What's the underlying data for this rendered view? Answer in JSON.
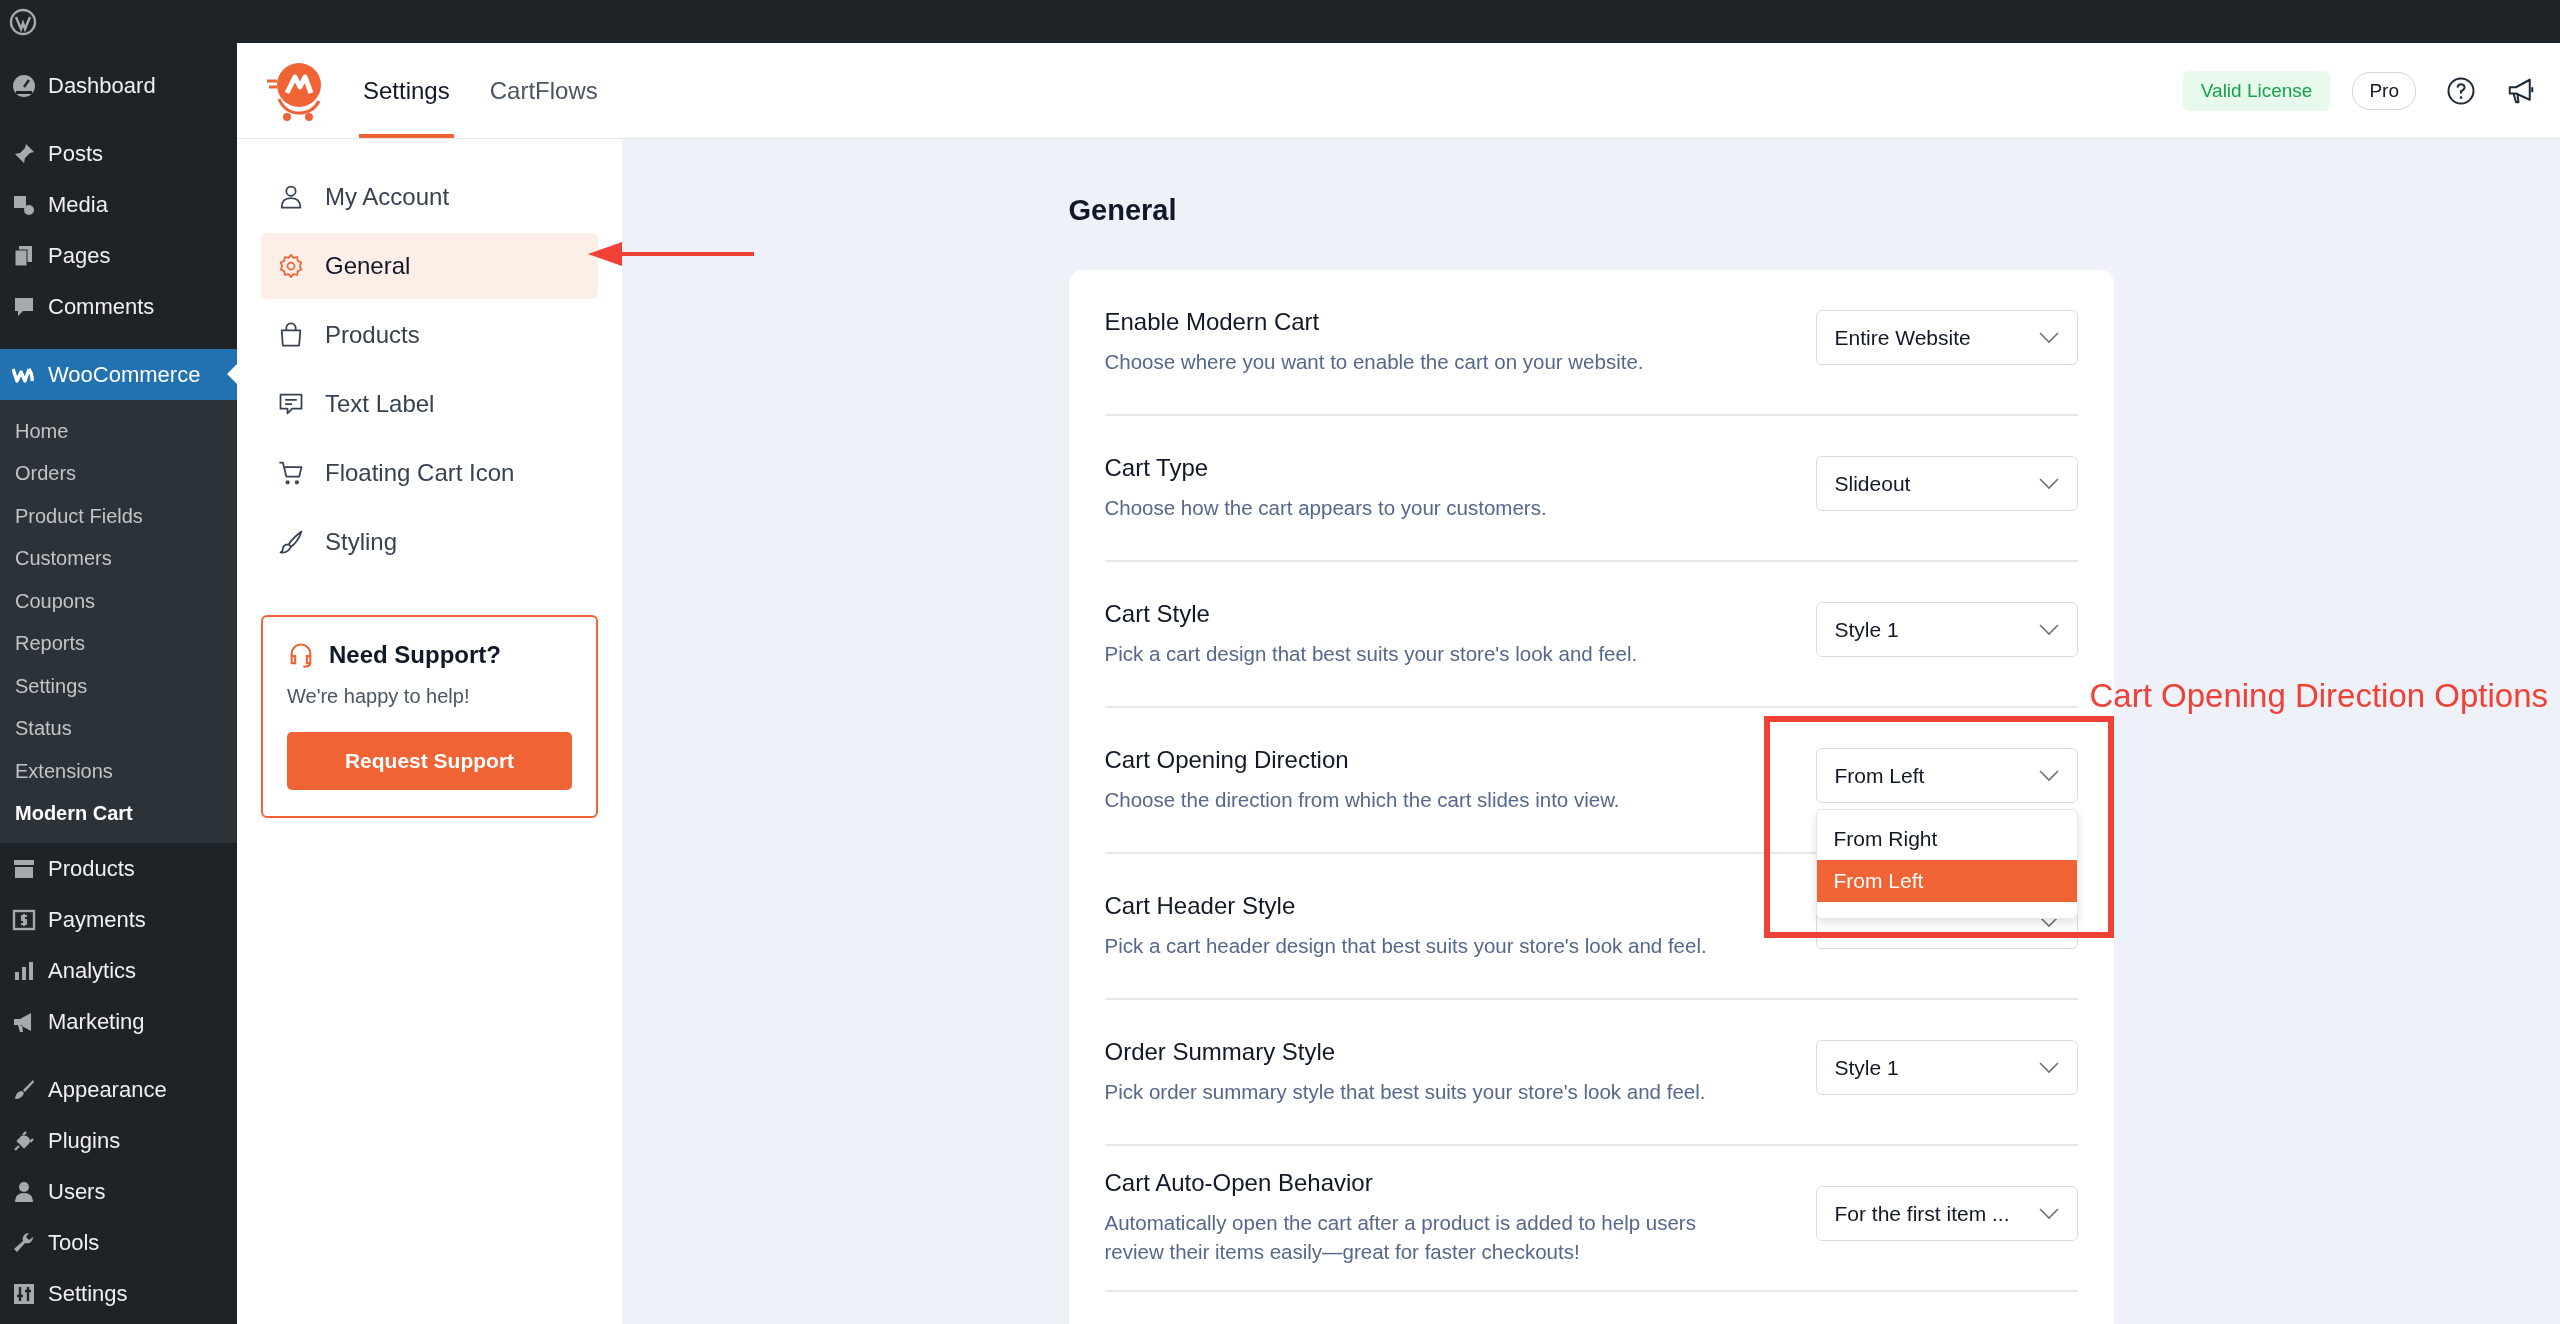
{
  "wp_menu": {
    "groups": [
      [
        {
          "label": "Dashboard",
          "selected": false
        }
      ],
      [
        {
          "label": "Posts",
          "selected": false
        },
        {
          "label": "Media",
          "selected": false
        },
        {
          "label": "Pages",
          "selected": false
        },
        {
          "label": "Comments",
          "selected": false
        }
      ],
      [
        {
          "label": "WooCommerce",
          "selected": true,
          "children": [
            {
              "label": "Home",
              "selected": false
            },
            {
              "label": "Orders",
              "selected": false
            },
            {
              "label": "Product Fields",
              "selected": false
            },
            {
              "label": "Customers",
              "selected": false
            },
            {
              "label": "Coupons",
              "selected": false
            },
            {
              "label": "Reports",
              "selected": false
            },
            {
              "label": "Settings",
              "selected": false
            },
            {
              "label": "Status",
              "selected": false
            },
            {
              "label": "Extensions",
              "selected": false
            },
            {
              "label": "Modern Cart",
              "selected": true
            }
          ]
        },
        {
          "label": "Products",
          "selected": false
        },
        {
          "label": "Payments",
          "selected": false
        },
        {
          "label": "Analytics",
          "selected": false
        },
        {
          "label": "Marketing",
          "selected": false
        }
      ],
      [
        {
          "label": "Appearance",
          "selected": false
        },
        {
          "label": "Plugins",
          "selected": false
        },
        {
          "label": "Users",
          "selected": false
        },
        {
          "label": "Tools",
          "selected": false
        },
        {
          "label": "Settings",
          "selected": false
        }
      ]
    ]
  },
  "header": {
    "tabs": [
      {
        "label": "Settings",
        "selected": true
      },
      {
        "label": "CartFlows",
        "selected": false
      }
    ],
    "license": "Valid License",
    "plan": "Pro"
  },
  "settings_nav": {
    "items": [
      {
        "label": "My Account",
        "selected": false
      },
      {
        "label": "General",
        "selected": true
      },
      {
        "label": "Products",
        "selected": false
      },
      {
        "label": "Text Label",
        "selected": false
      },
      {
        "label": "Floating Cart Icon",
        "selected": false
      },
      {
        "label": "Styling",
        "selected": false
      }
    ]
  },
  "support": {
    "title": "Need Support?",
    "text": "We're happy to help!",
    "button": "Request Support"
  },
  "page_title": "General",
  "settings": [
    {
      "label": "Enable Modern Cart",
      "description": "Choose where you want to enable the cart on your website.",
      "value": "Entire Website"
    },
    {
      "label": "Cart Type",
      "description": "Choose how the cart appears to your customers.",
      "value": "Slideout"
    },
    {
      "label": "Cart Style",
      "description": "Pick a cart design that best suits your store's look and feel.",
      "value": "Style 1"
    },
    {
      "label": "Cart Opening Direction",
      "description": "Choose the direction from which the cart slides into view.",
      "value": "From Left",
      "open": true,
      "options": [
        {
          "label": "From Right",
          "selected": false
        },
        {
          "label": "From Left",
          "selected": true
        }
      ]
    },
    {
      "label": "Cart Header Style",
      "description": "Pick a cart header design that best suits your store's look and feel."
    },
    {
      "label": "Order Summary Style",
      "description": "Pick order summary style that best suits your store's look and feel.",
      "value": "Style 1"
    },
    {
      "label": "Cart Auto-Open Behavior",
      "description": "Automatically open the cart after a product is added to help users review their items easily—great for faster checkouts!",
      "value": "For the first item ..."
    }
  ],
  "annotation": {
    "text": "Cart Opening Direction Options"
  }
}
